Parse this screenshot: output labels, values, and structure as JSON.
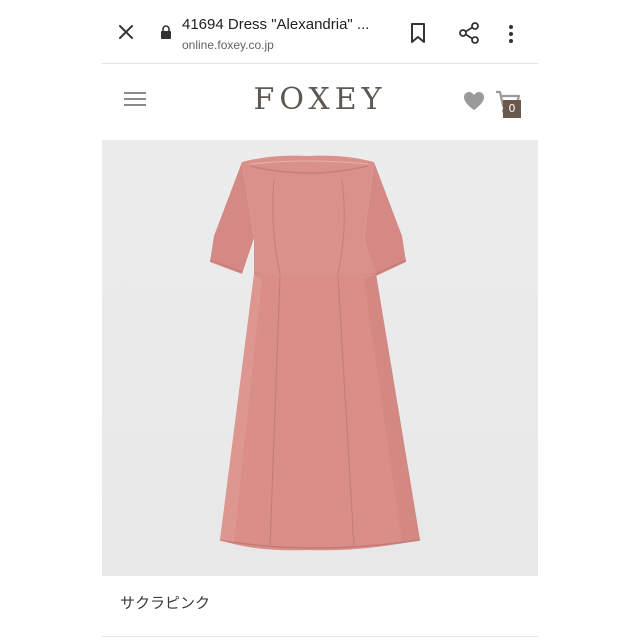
{
  "browser": {
    "tab_title": "41694 Dress \"Alexandria\" ...",
    "url": "online.foxey.co.jp",
    "icons": [
      "close-icon",
      "lock-icon",
      "bookmark-icon",
      "share-icon",
      "more-vert-icon"
    ]
  },
  "site": {
    "logo": "FOXEY",
    "cart_count": "0",
    "icons": [
      "hamburger-menu-icon",
      "heart-icon",
      "cart-icon"
    ]
  },
  "product": {
    "color_name": "サクラピンク",
    "dress_color": "#d98e88",
    "background_color": "#eaeaea"
  }
}
